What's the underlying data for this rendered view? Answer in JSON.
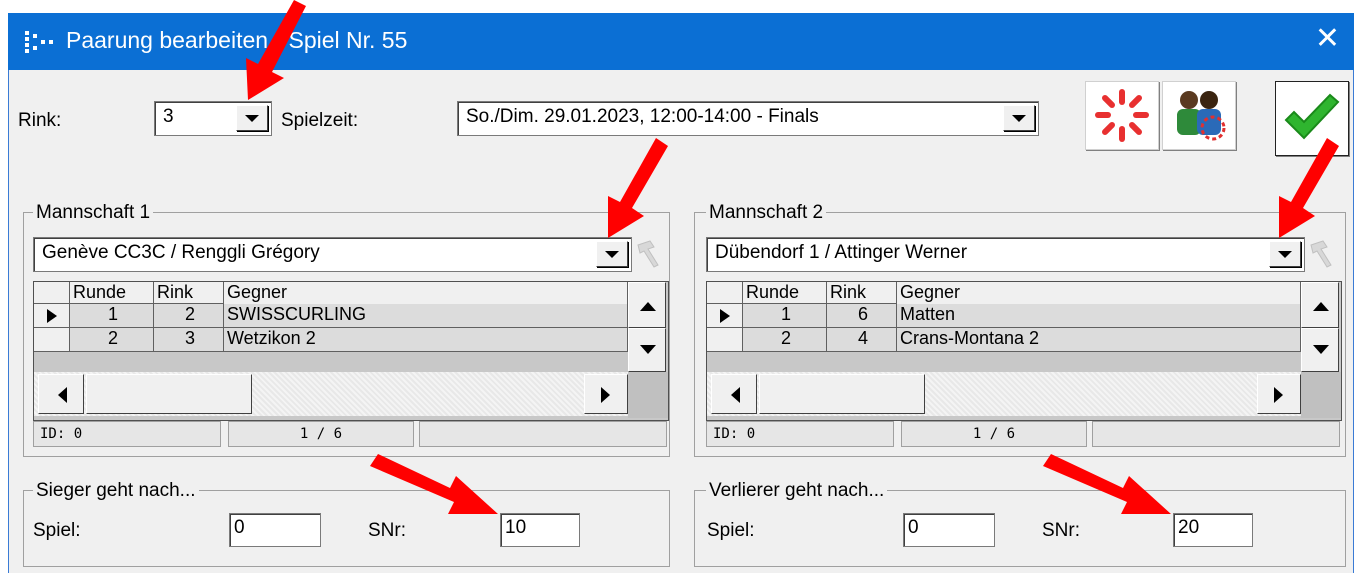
{
  "window": {
    "title": "Paarung bearbeiten - Spiel Nr. 55",
    "app_icon": "tournament-bracket-icon",
    "close_icon": "close-icon",
    "close_glyph": "✕"
  },
  "top": {
    "rink_label": "Rink:",
    "rink_value": "3",
    "spielzeit_label": "Spielzeit:",
    "spielzeit_value": "So./Dim. 29.01.2023, 12:00-14:00 - Finals"
  },
  "toolbar": {
    "buttons": [
      {
        "icon": "loading-spinner-icon"
      },
      {
        "icon": "people-network-icon"
      },
      {
        "icon": "checkmark-ok-icon"
      }
    ]
  },
  "team1": {
    "group_title": "Mannschaft 1",
    "selected": "Genève CC3C / Renggli Grégory",
    "columns": [
      "Runde",
      "Rink",
      "Gegner"
    ],
    "rows": [
      {
        "runde": "1",
        "rink": "2",
        "gegner": "SWISSCURLING"
      },
      {
        "runde": "2",
        "rink": "3",
        "gegner": "Wetzikon 2"
      }
    ],
    "status_id": "ID: 0",
    "status_pos": "1 / 6"
  },
  "team2": {
    "group_title": "Mannschaft 2",
    "selected": "Dübendorf 1 / Attinger Werner",
    "columns": [
      "Runde",
      "Rink",
      "Gegner"
    ],
    "rows": [
      {
        "runde": "1",
        "rink": "6",
        "gegner": "Matten"
      },
      {
        "runde": "2",
        "rink": "4",
        "gegner": "Crans-Montana 2"
      }
    ],
    "status_id": "ID: 0",
    "status_pos": "1 / 6"
  },
  "winner": {
    "group_title": "Sieger geht nach...",
    "spiel_label": "Spiel:",
    "spiel_value": "0",
    "snr_label": "SNr:",
    "snr_value": "10"
  },
  "loser": {
    "group_title": "Verlierer geht nach...",
    "spiel_label": "Spiel:",
    "spiel_value": "0",
    "snr_label": "SNr:",
    "snr_value": "20"
  },
  "colors": {
    "titlebar": "#0b6fd4",
    "annotation_arrow": "#ff0000",
    "check_green": "#2fb52f"
  }
}
